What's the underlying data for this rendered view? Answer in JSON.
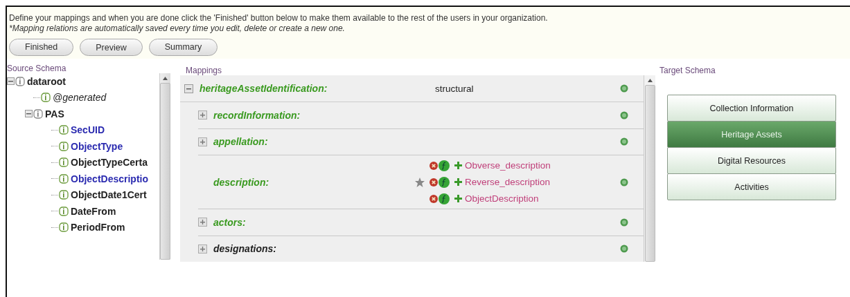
{
  "intro": {
    "text": "Define your mappings and when you are done click the 'Finished' button below to make them available to the rest of the users in your organization.",
    "note": "*Mapping relations are automatically saved every time you edit, delete or create a new one."
  },
  "buttons": [
    "Finished",
    "Preview",
    "Summary"
  ],
  "source_schema": {
    "title": "Source Schema",
    "tree": [
      {
        "label": "dataroot",
        "kind": "element",
        "mapped": false,
        "expanded": true,
        "children": [
          {
            "label": "@generated",
            "kind": "attribute",
            "mapped": false
          },
          {
            "label": "PAS",
            "kind": "element",
            "mapped": false,
            "expanded": true,
            "children": [
              {
                "label": "SecUID",
                "kind": "element",
                "mapped": true
              },
              {
                "label": "ObjectType",
                "kind": "element",
                "mapped": true
              },
              {
                "label": "ObjectTypeCerta",
                "kind": "element",
                "mapped": false
              },
              {
                "label": "ObjectDescriptio",
                "kind": "element",
                "mapped": true
              },
              {
                "label": "ObjectDate1Cert",
                "kind": "element",
                "mapped": false
              },
              {
                "label": "DateFrom",
                "kind": "element",
                "mapped": false
              },
              {
                "label": "PeriodFrom",
                "kind": "element",
                "mapped": false
              }
            ]
          }
        ]
      }
    ]
  },
  "mappings": {
    "title": "Mappings",
    "root": {
      "label": "heritageAssetIdentification:",
      "value": "structural",
      "expanded": true,
      "mapped": true
    },
    "rows": [
      {
        "label": "recordInformation:",
        "expandable": true,
        "mapped": true
      },
      {
        "label": "appellation:",
        "expandable": true,
        "mapped": true
      },
      {
        "label": "description:",
        "expandable": false,
        "mapped": true,
        "targets": [
          "Obverse_description",
          "Reverse_description",
          "ObjectDescription"
        ]
      },
      {
        "label": "actors:",
        "expandable": true,
        "mapped": true
      },
      {
        "label": "designations:",
        "expandable": true,
        "mapped": false
      }
    ]
  },
  "target_schema": {
    "title": "Target Schema",
    "items": [
      {
        "label": "Collection Information",
        "selected": false
      },
      {
        "label": "Heritage Assets",
        "selected": true
      },
      {
        "label": "Digital Resources",
        "selected": false
      },
      {
        "label": "Activities",
        "selected": false
      }
    ]
  }
}
